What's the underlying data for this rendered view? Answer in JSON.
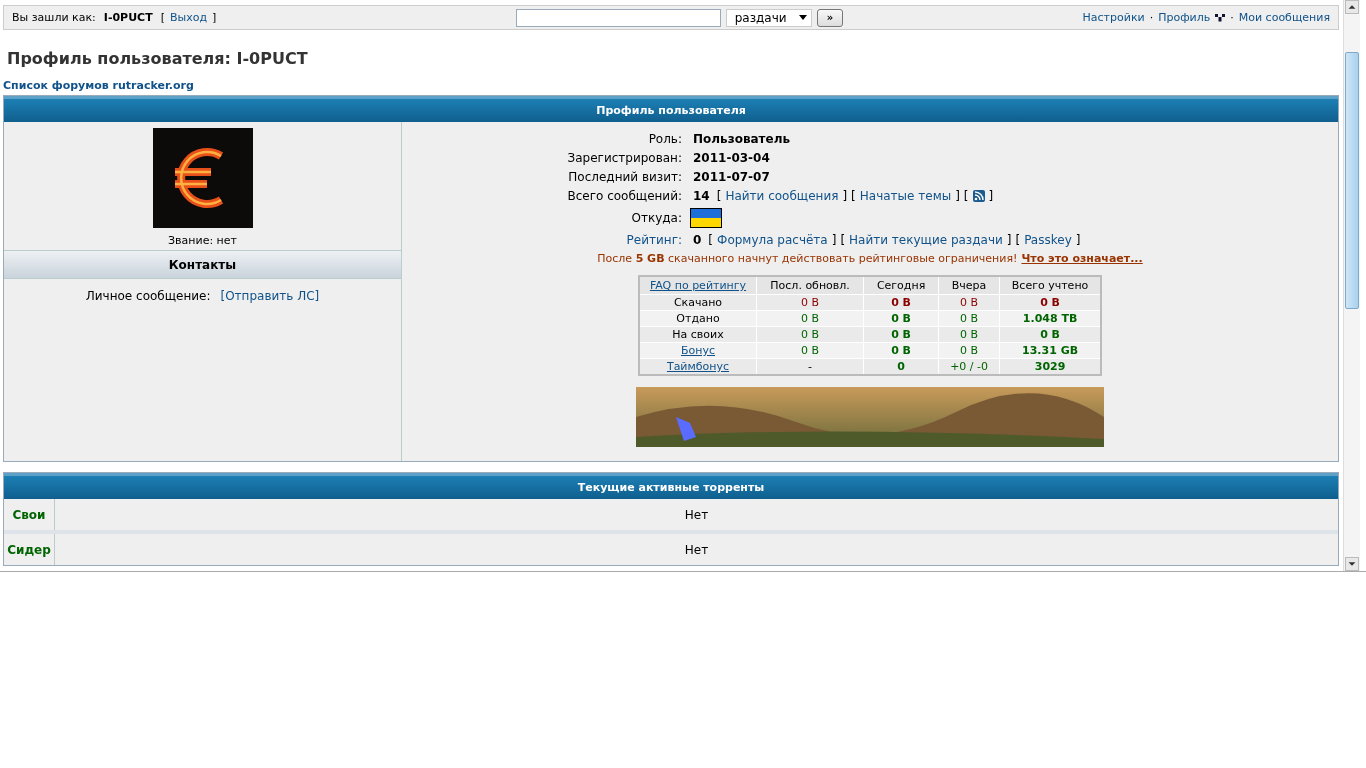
{
  "top_bar": {
    "logged_in": [
      {
        "kind": "text",
        "text": "Вы зашли как:"
      },
      {
        "kind": "bold",
        "text": "I-0PUCT"
      },
      {
        "kind": "text",
        "text": "["
      },
      {
        "kind": "link",
        "text": "Выход"
      },
      {
        "kind": "text",
        "text": "]"
      }
    ],
    "search": {
      "category": "раздачи",
      "submit": "»"
    },
    "links": [
      {
        "kind": "link",
        "text": "Настройки"
      },
      {
        "kind": "text",
        "text": "·"
      },
      {
        "kind": "link",
        "text": "Профиль"
      },
      {
        "kind": "icon"
      },
      {
        "kind": "text",
        "text": "·"
      },
      {
        "kind": "link",
        "text": "Мои сообщения"
      }
    ]
  },
  "page_title": "Профиль пользователя: I-0PUCT",
  "breadcrumb": "Список форумов rutracker.org",
  "profile": {
    "header": "Профиль пользователя",
    "rank": "Звание: нет",
    "contacts_header": "Контакты",
    "contact": {
      "label": "Личное сообщение:",
      "link": "[Отправить ЛС]"
    },
    "fields": [
      {
        "label": "Роль:",
        "link_label": false,
        "parts": [
          {
            "kind": "bold",
            "text": "Пользователь"
          }
        ]
      },
      {
        "label": "Зарегистрирован:",
        "link_label": false,
        "parts": [
          {
            "kind": "bold",
            "text": "2011-03-04"
          }
        ]
      },
      {
        "label": "Последний визит:",
        "link_label": false,
        "parts": [
          {
            "kind": "bold",
            "text": "2011-07-07"
          }
        ]
      },
      {
        "label": "Всего сообщений:",
        "link_label": false,
        "parts": [
          {
            "kind": "bold",
            "text": "14"
          },
          {
            "kind": "text",
            "text": "["
          },
          {
            "kind": "link",
            "text": "Найти сообщения"
          },
          {
            "kind": "text",
            "text": "]"
          },
          {
            "kind": "text",
            "text": "["
          },
          {
            "kind": "link",
            "text": "Начатые темы"
          },
          {
            "kind": "text",
            "text": "]"
          },
          {
            "kind": "text",
            "text": "["
          },
          {
            "kind": "rss"
          },
          {
            "kind": "text",
            "text": "]"
          }
        ]
      },
      {
        "label": "Откуда:",
        "link_label": false,
        "parts": [
          {
            "kind": "flag"
          }
        ]
      },
      {
        "label": "Рейтинг:",
        "link_label": true,
        "parts": [
          {
            "kind": "bold",
            "text": "0"
          },
          {
            "kind": "text",
            "text": "["
          },
          {
            "kind": "link",
            "text": "Формула расчёта"
          },
          {
            "kind": "text",
            "text": "]"
          },
          {
            "kind": "text",
            "text": "["
          },
          {
            "kind": "link",
            "text": "Найти текущие раздачи"
          },
          {
            "kind": "text",
            "text": "]"
          },
          {
            "kind": "text",
            "text": "["
          },
          {
            "kind": "link",
            "text": "Passkey"
          },
          {
            "kind": "text",
            "text": "]"
          }
        ]
      }
    ],
    "notice": {
      "text": "После **5 GB** скачанного начнут действовать рейтинговые ограничения!",
      "link": "Что это означает..."
    },
    "stats": {
      "columns": [
        {
          "text": "FAQ по рейтингу",
          "link": true
        },
        {
          "text": "Посл. обновл.",
          "link": false
        },
        {
          "text": "Сегодня",
          "link": false
        },
        {
          "text": "Вчера",
          "link": false
        },
        {
          "text": "Всего учтено",
          "link": false
        }
      ],
      "rows": [
        {
          "cells": [
            {
              "text": "Скачано",
              "link": false
            },
            {
              "text": "0 B",
              "color": "#8b0000",
              "bold": false
            },
            {
              "text": "0 B",
              "color": "#8b0000",
              "bold": true
            },
            {
              "text": "0 B",
              "color": "#8b0000",
              "bold": false
            },
            {
              "text": "0 B",
              "color": "#8b0000",
              "bold": true
            }
          ]
        },
        {
          "cells": [
            {
              "text": "Отдано",
              "link": false
            },
            {
              "text": "0 B",
              "color": "#006400",
              "bold": false
            },
            {
              "text": "0 B",
              "color": "#006400",
              "bold": true
            },
            {
              "text": "0 B",
              "color": "#006400",
              "bold": false
            },
            {
              "text": "1.048 TB",
              "color": "#006400",
              "bold": true
            }
          ]
        },
        {
          "cells": [
            {
              "text": "На своих",
              "link": false
            },
            {
              "text": "0 B",
              "color": "#006400",
              "bold": false
            },
            {
              "text": "0 B",
              "color": "#006400",
              "bold": true
            },
            {
              "text": "0 B",
              "color": "#006400",
              "bold": false
            },
            {
              "text": "0 B",
              "color": "#006400",
              "bold": true
            }
          ]
        },
        {
          "cells": [
            {
              "text": "Бонус",
              "link": true
            },
            {
              "text": "0 B",
              "color": "#006400",
              "bold": false
            },
            {
              "text": "0 B",
              "color": "#006400",
              "bold": true
            },
            {
              "text": "0 B",
              "color": "#006400",
              "bold": false
            },
            {
              "text": "13.31 GB",
              "color": "#006400",
              "bold": true
            }
          ]
        },
        {
          "cells": [
            {
              "text": "Таймбонус",
              "link": true
            },
            {
              "text": "-",
              "bold": false
            },
            {
              "text": "0",
              "color": "#006400",
              "bold": true
            },
            {
              "text": "+0 / -0",
              "color": "#006400",
              "bold": false
            },
            {
              "text": "3029",
              "color": "#006400",
              "bold": true
            }
          ]
        }
      ]
    }
  },
  "torrents": {
    "header": "Текущие активные торренты",
    "rows": [
      {
        "label": "Свои",
        "value": "Нет"
      },
      {
        "label": "Сидер",
        "value": "Нет"
      }
    ]
  }
}
